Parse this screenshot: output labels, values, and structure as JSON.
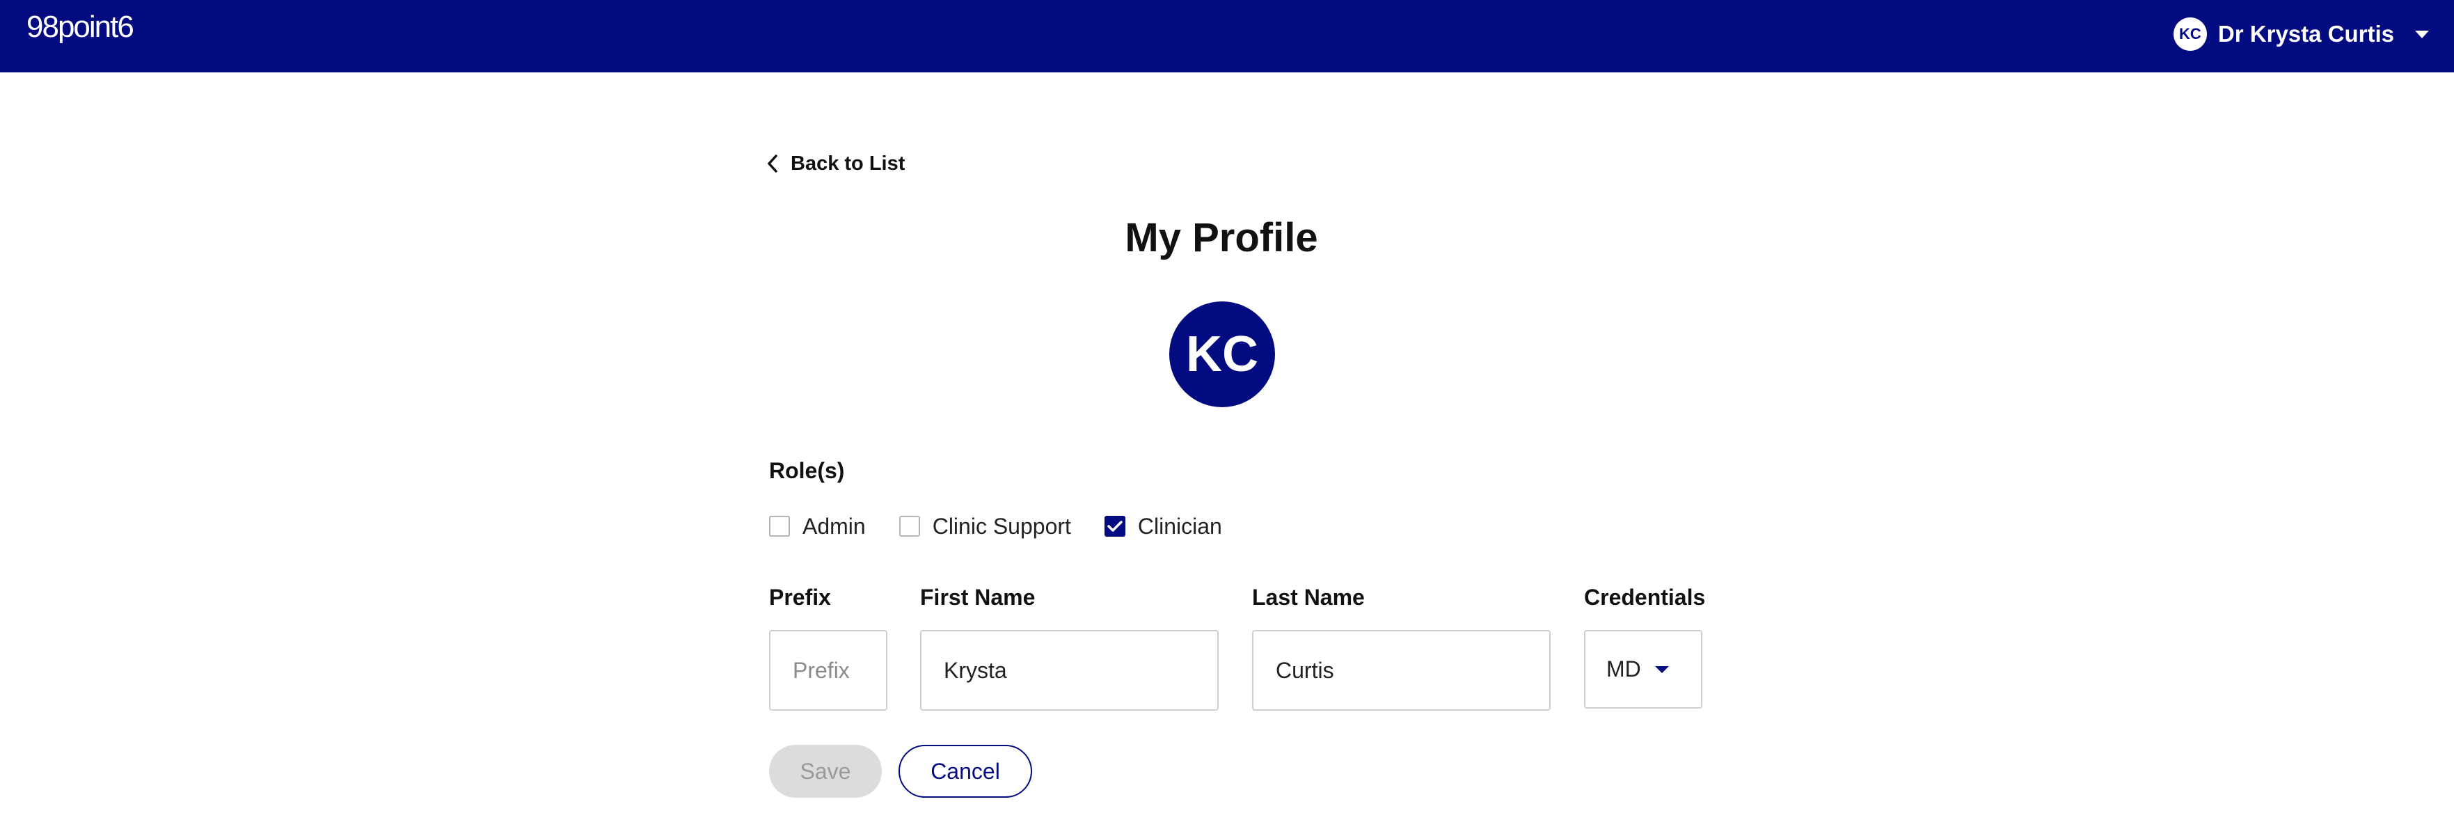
{
  "header": {
    "logo": "98point6",
    "user": {
      "initials": "KC",
      "name": "Dr Krysta Curtis"
    }
  },
  "nav": {
    "back_label": "Back to List"
  },
  "page": {
    "title": "My Profile",
    "avatar_initials": "KC"
  },
  "roles": {
    "label": "Role(s)",
    "options": [
      {
        "label": "Admin",
        "checked": false
      },
      {
        "label": "Clinic Support",
        "checked": false
      },
      {
        "label": "Clinician",
        "checked": true
      }
    ]
  },
  "form": {
    "prefix": {
      "label": "Prefix",
      "value": "",
      "placeholder": "Prefix"
    },
    "first_name": {
      "label": "First Name",
      "value": "Krysta"
    },
    "last_name": {
      "label": "Last Name",
      "value": "Curtis"
    },
    "credentials": {
      "label": "Credentials",
      "value": "MD"
    }
  },
  "actions": {
    "save_label": "Save",
    "cancel_label": "Cancel"
  },
  "colors": {
    "brand": "#030b80",
    "disabled": "#dcdcdc"
  },
  "icons": {
    "back": "chevron-left-icon",
    "user_menu": "caret-down-icon",
    "select": "caret-down-icon",
    "check": "checkmark-icon"
  }
}
